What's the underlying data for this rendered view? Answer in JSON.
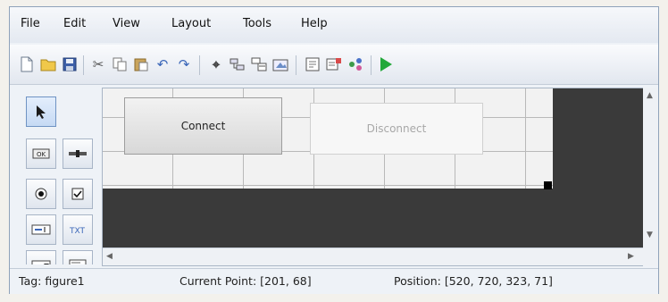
{
  "menu": [
    "File",
    "Edit",
    "View",
    "Layout",
    "Tools",
    "Help"
  ],
  "toolbar_icons": [
    "new-file-icon",
    "open-folder-icon",
    "save-icon",
    "cut-icon",
    "copy-icon",
    "paste-icon",
    "undo-icon",
    "redo-icon",
    "align-icon",
    "tab-order-icon",
    "menu-editor-icon",
    "toolbar-editor-icon",
    "editor-icon",
    "property-inspector-icon",
    "object-browser-icon",
    "run-icon"
  ],
  "palette": [
    "select-tool-icon",
    "push-button-tool-icon",
    "slider-tool-icon",
    "radio-button-tool-icon",
    "checkbox-tool-icon",
    "edit-text-tool-icon",
    "static-text-tool-icon",
    "popup-menu-tool-icon",
    "listbox-tool-icon"
  ],
  "canvas": {
    "connect_label": "Connect",
    "disconnect_label": "Disconnect"
  },
  "status": {
    "tag": "Tag: figure1",
    "current_point": "Current Point: [201, 68]",
    "position": "Position: [520, 720, 323, 71]"
  },
  "colors": {
    "run_icon": "#22a83a",
    "dark_panel": "#3a3a3a"
  }
}
